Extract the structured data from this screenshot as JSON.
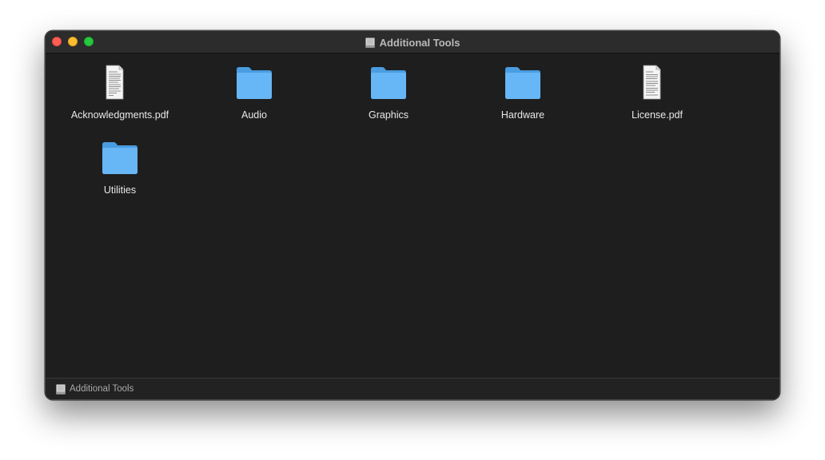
{
  "window": {
    "title": "Additional Tools",
    "title_icon": "disk-image-icon"
  },
  "items": [
    {
      "label": "Acknowledgments.pdf",
      "icon": "pdf-document-icon"
    },
    {
      "label": "Audio",
      "icon": "folder-icon"
    },
    {
      "label": "Graphics",
      "icon": "folder-icon"
    },
    {
      "label": "Hardware",
      "icon": "folder-icon"
    },
    {
      "label": "License.pdf",
      "icon": "pdf-document-icon"
    },
    {
      "label": "Utilities",
      "icon": "folder-icon"
    }
  ],
  "statusbar": {
    "path_label": "Additional Tools",
    "path_icon": "disk-image-icon"
  },
  "colors": {
    "folder": "#5aaef0",
    "window_bg": "#1e1e1e",
    "close": "#fe5f57",
    "minimize": "#febc2e",
    "zoom": "#28c840"
  }
}
